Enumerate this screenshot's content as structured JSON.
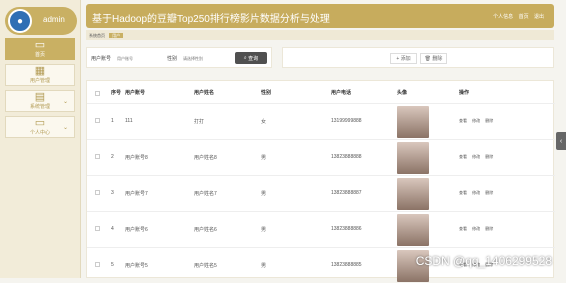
{
  "brand": {
    "username": "admin"
  },
  "sidebar": {
    "items": [
      {
        "label": "首页",
        "icon": "chat-icon"
      },
      {
        "label": "用户管理",
        "icon": "grid-icon"
      },
      {
        "label": "系统管理",
        "icon": "folder-icon"
      },
      {
        "label": "个人中心",
        "icon": "card-icon"
      }
    ]
  },
  "header": {
    "title": "基于Hadoop的豆瓣Top250排行榜影片数据分析与处理",
    "links": [
      "个人信息",
      "首页",
      "退出"
    ]
  },
  "breadcrumb": {
    "home": "系统首页",
    "current": "用户"
  },
  "search": {
    "account_label": "用户账号",
    "account_placeholder": "用户账号",
    "gender_label": "性别",
    "gender_placeholder": "请选择性别",
    "button": "查询"
  },
  "actions": {
    "add": "添加",
    "delete": "删除"
  },
  "table": {
    "headers": [
      "序号",
      "用户账号",
      "用户姓名",
      "性别",
      "用户电话",
      "头像",
      "操作"
    ],
    "rows": [
      {
        "no": "1",
        "account": "111",
        "name": "打打",
        "gender": "女",
        "phone": "13199999888"
      },
      {
        "no": "2",
        "account": "用户账号8",
        "name": "用户姓名8",
        "gender": "男",
        "phone": "13823888888"
      },
      {
        "no": "3",
        "account": "用户账号7",
        "name": "用户姓名7",
        "gender": "男",
        "phone": "13823888887"
      },
      {
        "no": "4",
        "account": "用户账号6",
        "name": "用户姓名6",
        "gender": "男",
        "phone": "13823888886"
      },
      {
        "no": "5",
        "account": "用户账号5",
        "name": "用户姓名5",
        "gender": "男",
        "phone": "13823888885"
      }
    ],
    "row_actions": [
      "查看",
      "修改",
      "删除"
    ]
  },
  "watermark": "CSDN @qq_1406299528",
  "colors": {
    "accent": "#c7ac5d",
    "dark_button": "#505050"
  }
}
